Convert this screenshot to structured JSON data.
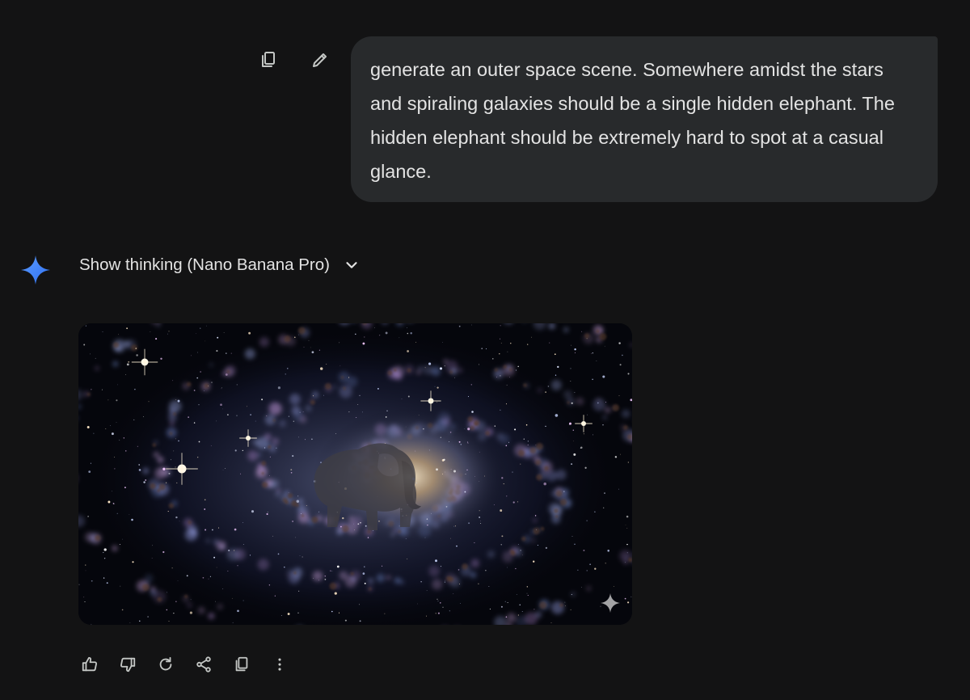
{
  "prompt": {
    "text": "generate an outer space scene. Somewhere amidst the stars and spiraling galaxies should be a single hidden elephant. The hidden elephant should be extremely hard to spot at a casual glance.",
    "actions": [
      "copy-icon",
      "edit-icon"
    ]
  },
  "response": {
    "thinking_label": "Show thinking (Nano Banana Pro)",
    "image": {
      "subject": "spiral galaxy with an elephant at its core",
      "watermark_icon": "sparkle-icon"
    },
    "actions": [
      "thumbs-up-icon",
      "thumbs-down-icon",
      "regenerate-icon",
      "share-icon",
      "copy-icon",
      "more-vert-icon"
    ]
  },
  "colors": {
    "background": "#131314",
    "bubble": "#282a2c",
    "text": "#e3e3e3",
    "icon": "#c4c7c5",
    "gemini_blue": "#4285f4"
  }
}
